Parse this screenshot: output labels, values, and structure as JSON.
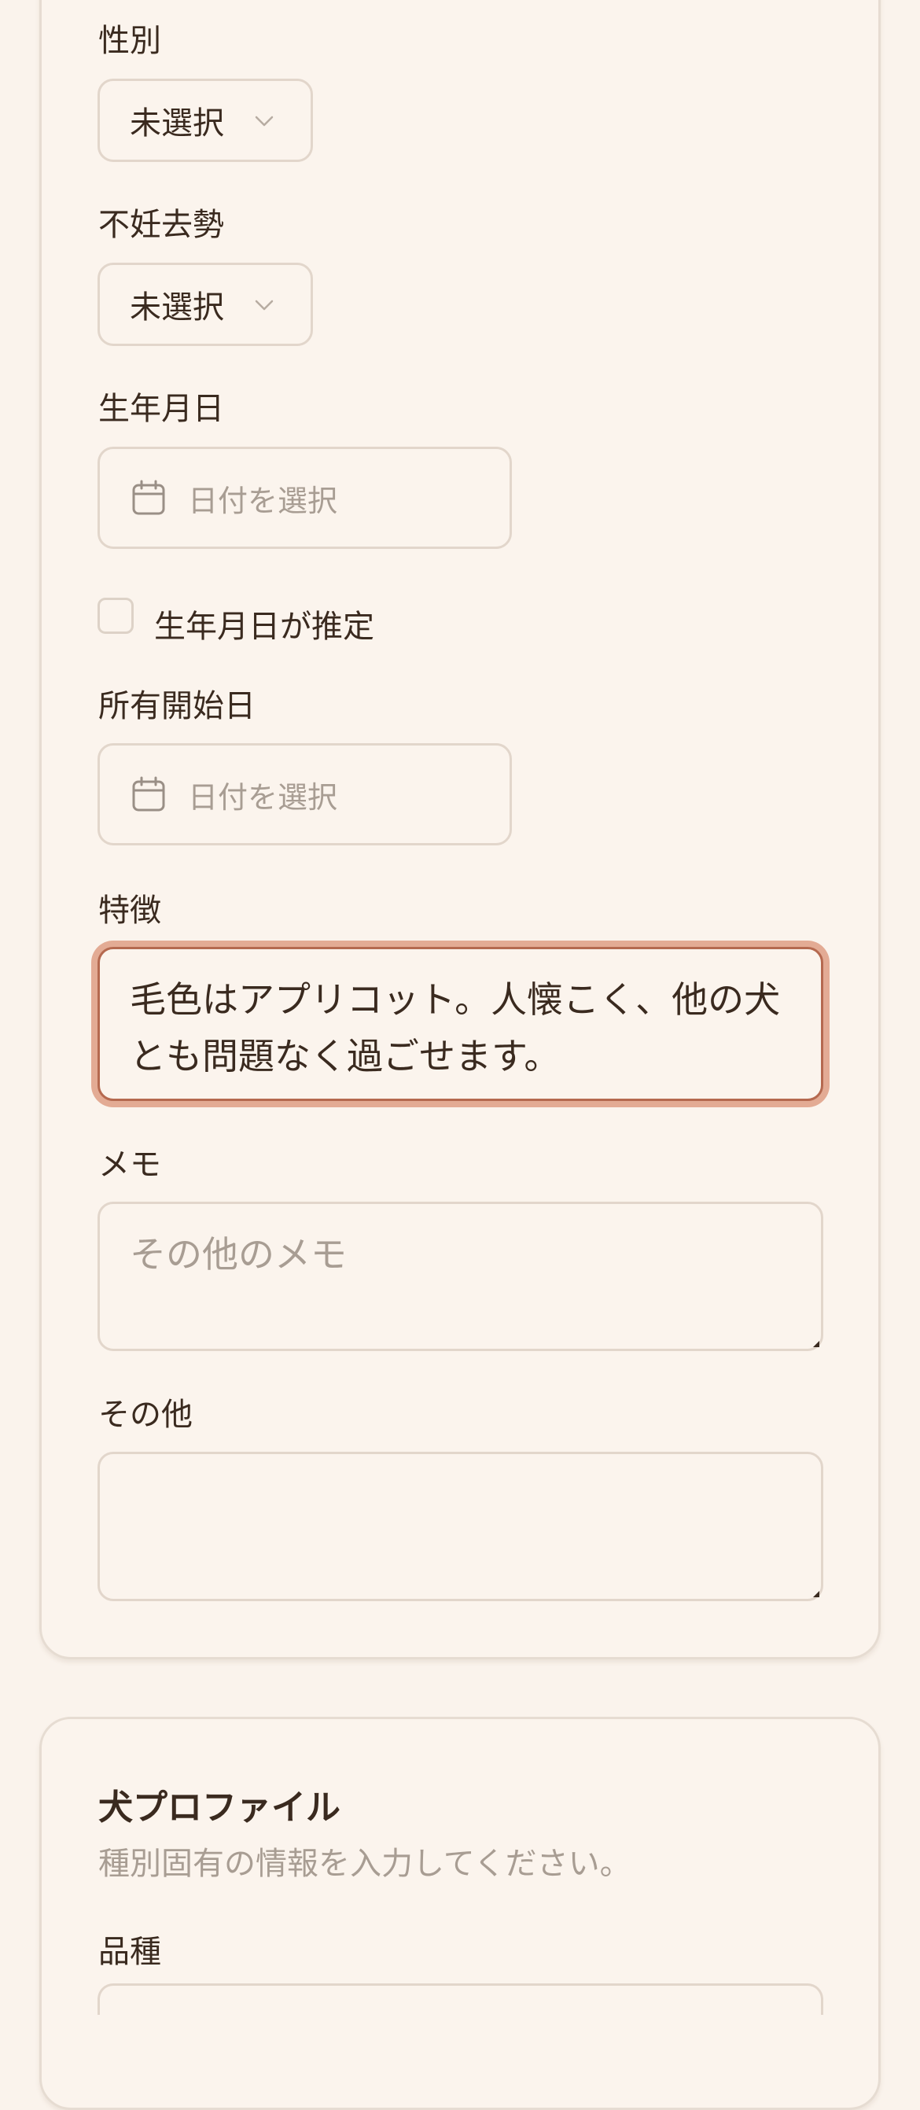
{
  "form": {
    "sex": {
      "label": "性別",
      "value": "未選択"
    },
    "neuter": {
      "label": "不妊去勢",
      "value": "未選択"
    },
    "birthdate": {
      "label": "生年月日",
      "placeholder": "日付を選択"
    },
    "birthdate_estimated": {
      "label": "生年月日が推定",
      "checked": false
    },
    "ownership_start": {
      "label": "所有開始日",
      "placeholder": "日付を選択"
    },
    "features": {
      "label": "特徴",
      "value": "毛色はアプリコット。人懐こく、他の犬とも問題なく過ごせます。"
    },
    "memo": {
      "label": "メモ",
      "placeholder": "その他のメモ",
      "value": ""
    },
    "other": {
      "label": "その他",
      "value": ""
    }
  },
  "dog_profile": {
    "title": "犬プロファイル",
    "description": "種別固有の情報を入力してください。",
    "breed": {
      "label": "品種"
    }
  },
  "colors": {
    "background": "#faf3ec",
    "border": "#e2d6cb",
    "focus_ring": "#e3ab94",
    "focus_border": "#b5694f",
    "text": "#3a2a1f",
    "placeholder": "#a89d93"
  },
  "icons": {
    "select_chevron": "chevron-down-icon",
    "date": "calendar-icon"
  }
}
